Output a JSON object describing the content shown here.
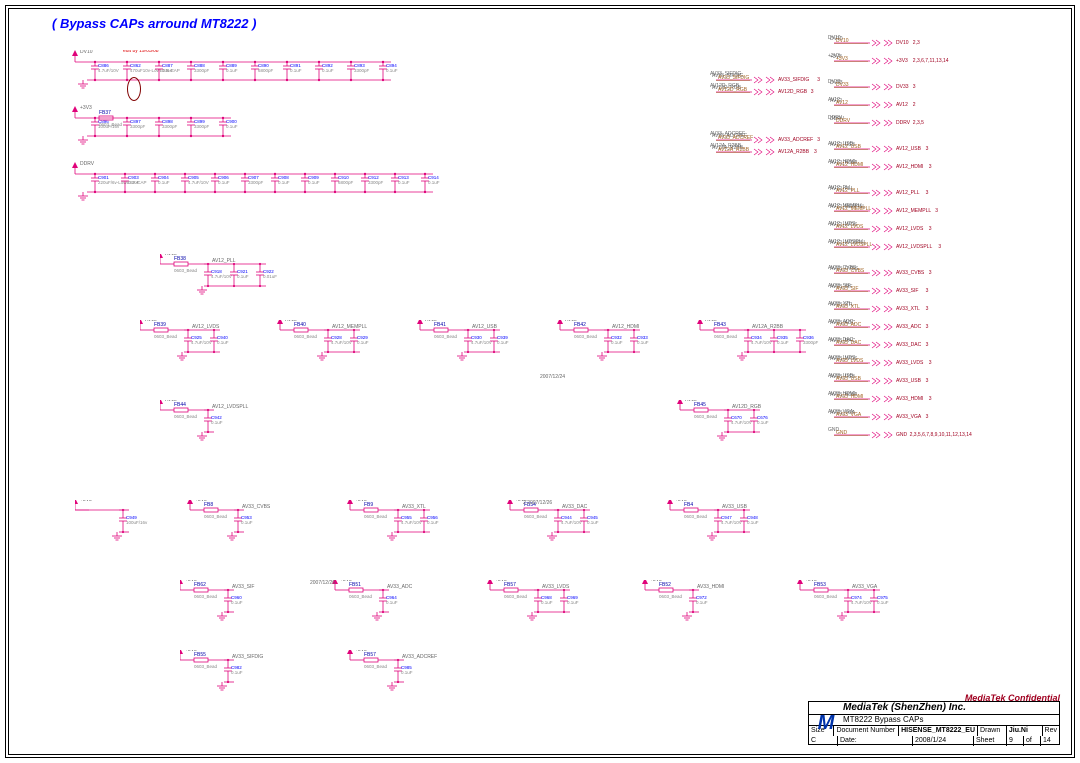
{
  "title": "( Bypass CAPs arround MT8222 )",
  "notes": {
    "edit": "edit by 19/05/08",
    "date1": "2007/12/24",
    "date2": "2 2007/12/26",
    "date3": "2007/12/26"
  },
  "confidential": "MediaTek Confidential",
  "titleblock": {
    "company": "MediaTek (ShenZhen) Inc.",
    "project": "MT8222 Bypass CAPs",
    "size": "Size",
    "size_v": "C",
    "docnum": "Document Number",
    "docnum_v": "HISENSE_MT8222_EU",
    "rev": "Rev",
    "rev_v": "1",
    "date": "Date:",
    "date_v": "2008/1/24",
    "sheet": "Sheet",
    "sheet_v": "9",
    "of": "of",
    "of_v": "14",
    "drawn": "Drawn",
    "drawn_v": "Jiu.Ni"
  },
  "rows_top": [
    {
      "net": "DV10",
      "caps": [
        {
          "ref": "C886",
          "val": "4.7uF/10V"
        },
        {
          "ref": "C862",
          "val": "470uF10v-LowESR-CAP"
        },
        {
          "ref": "C887",
          "val": "0.1uF"
        },
        {
          "ref": "C888",
          "val": "3300pF"
        },
        {
          "ref": "C889",
          "val": "0.1uF"
        },
        {
          "ref": "C890",
          "val": "6800pF"
        },
        {
          "ref": "C891",
          "val": "0.1uF"
        },
        {
          "ref": "C892",
          "val": "0.1uF"
        },
        {
          "ref": "C893",
          "val": "3300pF"
        },
        {
          "ref": "C894",
          "val": "0.1uF"
        }
      ]
    },
    {
      "net": "+3V3",
      "bead": {
        "ref": "FB37",
        "val": "0603_Bead"
      },
      "d": {
        "ref": "D103",
        "val": ""
      },
      "caps": [
        {
          "ref": "C896",
          "val": "100uF/16v"
        },
        {
          "ref": "C897",
          "val": "3300pF"
        },
        {
          "ref": "C898",
          "val": "3300pF"
        },
        {
          "ref": "C899",
          "val": "3300pF"
        },
        {
          "ref": "C900",
          "val": "0.1uF"
        }
      ]
    },
    {
      "net": "DDRV",
      "caps": [
        {
          "ref": "C901",
          "val": "220uF/6v-LowESR-CAP"
        },
        {
          "ref": "C903",
          "val": "0.1uF"
        },
        {
          "ref": "C904",
          "val": "0.1uF"
        },
        {
          "ref": "C905",
          "val": "4.7uF/10V"
        },
        {
          "ref": "C906",
          "val": "0.1uF"
        },
        {
          "ref": "C907",
          "val": "3300pF"
        },
        {
          "ref": "C908",
          "val": "0.1uF"
        },
        {
          "ref": "C909",
          "val": "0.1uF"
        },
        {
          "ref": "C910",
          "val": "6800pF"
        },
        {
          "ref": "C912",
          "val": "3300pF"
        },
        {
          "ref": "C913",
          "val": "0.1uF"
        },
        {
          "ref": "C914",
          "val": "0.1uF"
        }
      ]
    }
  ],
  "av12_pll": {
    "net": "AV12",
    "bead": {
      "ref": "FB38",
      "val": "0603_Bead"
    },
    "out": "AV12_PLL",
    "caps": [
      {
        "ref": "C918",
        "val": "4.7uF/10V"
      },
      {
        "ref": "C921",
        "val": "0.1uF"
      },
      {
        "ref": "C922",
        "val": "0.01uF"
      }
    ]
  },
  "mid_clusters": [
    {
      "net": "AV12",
      "bead": {
        "ref": "FB39",
        "val": "0603_Bead"
      },
      "out": "AV12_LVDS",
      "caps": [
        {
          "ref": "C925",
          "val": "4.7uF/10V"
        },
        {
          "ref": "C940",
          "val": "0.1uF"
        }
      ]
    },
    {
      "net": "AV12",
      "bead": {
        "ref": "FB40",
        "val": "0603_Bead"
      },
      "out": "AV12_MEMPLL",
      "caps": [
        {
          "ref": "C928",
          "val": "4.7uF/10V"
        },
        {
          "ref": "C929",
          "val": "0.1uF"
        }
      ]
    },
    {
      "net": "AV12",
      "bead": {
        "ref": "FB41",
        "val": "0603_Bead"
      },
      "out": "AV12_USB",
      "caps": [
        {
          "ref": "C930",
          "val": "4.7uF/10V"
        },
        {
          "ref": "C939",
          "val": "0.1uF"
        }
      ]
    },
    {
      "net": "AV12",
      "bead": {
        "ref": "FB42",
        "val": "0603_Bead"
      },
      "out": "AV12_HDMI",
      "caps": [
        {
          "ref": "C932",
          "val": "0.1uF"
        },
        {
          "ref": "C933",
          "val": "0.1uF"
        }
      ]
    },
    {
      "net": "AV12",
      "bead": {
        "ref": "FB43",
        "val": "0603_Bead"
      },
      "out": "AV12A_R2BB",
      "caps": [
        {
          "ref": "C934",
          "val": "4.7uF/10V"
        },
        {
          "ref": "C935",
          "val": "0.1uF"
        },
        {
          "ref": "C936",
          "val": "3300pF"
        }
      ]
    }
  ],
  "lvdspll": {
    "net": "AV12",
    "bead": {
      "ref": "FB44",
      "val": "0603_Bead"
    },
    "out": "AV12_LVDSPLL",
    "caps": [
      {
        "ref": "C942",
        "val": "0.1uF"
      }
    ]
  },
  "av12d_rgb": {
    "net": "AV12",
    "bead": {
      "ref": "FB45",
      "val": "0603_Bead"
    },
    "out": "AV12D_RGB",
    "caps": [
      {
        "ref": "C670",
        "val": "4.7uF/10V"
      },
      {
        "ref": "C676",
        "val": "0.1uF"
      }
    ]
  },
  "row_block_b": [
    {
      "net": "+3V3",
      "bead": null,
      "out": "",
      "caps": [
        {
          "ref": "C949",
          "val": "100uF/16v"
        }
      ]
    },
    {
      "net": "+3V3",
      "bead": {
        "ref": "FB8",
        "val": "0603_Bead"
      },
      "out": "AV33_CVBS",
      "caps": [
        {
          "ref": "C953",
          "val": "0.1uF"
        }
      ]
    },
    {
      "net": "+3V3",
      "bead": {
        "ref": "FB9",
        "val": "0603_Bead"
      },
      "out": "AV33_XTL",
      "caps": [
        {
          "ref": "C955",
          "val": "4.7uF/10V"
        },
        {
          "ref": "C956",
          "val": "0.1uF"
        }
      ]
    },
    {
      "net": "+3V3",
      "bead": {
        "ref": "FB54",
        "val": "0603_Bead"
      },
      "out": "AV33_DAC",
      "caps": [
        {
          "ref": "C944",
          "val": "4.7uF/10V"
        },
        {
          "ref": "C945",
          "val": "0.1uF"
        }
      ]
    },
    {
      "net": "+3V3",
      "bead": {
        "ref": "FB4",
        "val": "0603_Bead"
      },
      "out": "AV33_USB",
      "caps": [
        {
          "ref": "C947",
          "val": "4.7uF/10V"
        },
        {
          "ref": "C948",
          "val": "0.1uF"
        }
      ]
    }
  ],
  "row_block_c": [
    {
      "net": "+3V3",
      "bead": {
        "ref": "FB62",
        "val": "0603_Bead"
      },
      "out": "AV33_SIF",
      "caps": [
        {
          "ref": "C960",
          "val": "0.1uF"
        }
      ]
    },
    {
      "net": "+3V3",
      "bead": {
        "ref": "FB51",
        "val": "0603_Bead"
      },
      "out": "AV33_ADC",
      "caps": [
        {
          "ref": "C964",
          "val": "0.1uF"
        }
      ]
    },
    {
      "net": "+3V3",
      "bead": {
        "ref": "FB57",
        "val": "0603_Bead"
      },
      "out": "AV33_LVDS",
      "caps": [
        {
          "ref": "C968",
          "val": "0.1uF"
        },
        {
          "ref": "C969",
          "val": "0.1uF"
        }
      ]
    },
    {
      "net": "+3V3",
      "bead": {
        "ref": "FB52",
        "val": "0603_Bead"
      },
      "out": "AV33_HDMI",
      "caps": [
        {
          "ref": "C972",
          "val": "0.1uF"
        }
      ]
    },
    {
      "net": "+3V3",
      "bead": {
        "ref": "FB53",
        "val": "0603_Bead"
      },
      "out": "AV33_VGA",
      "caps": [
        {
          "ref": "C974",
          "val": "4.7uF/10V"
        },
        {
          "ref": "C975",
          "val": "0.1uF"
        }
      ]
    }
  ],
  "row_block_d": [
    {
      "net": "+3V3",
      "bead": {
        "ref": "FB55",
        "val": "0603_Bead"
      },
      "out": "AV33_SIFDIG",
      "caps": [
        {
          "ref": "C982",
          "val": "0.1uF"
        }
      ]
    },
    {
      "net": "+3V3",
      "bead": {
        "ref": "FB57",
        "val": "0603_Bead"
      },
      "out": "AV33_ADCREF",
      "caps": [
        {
          "ref": "C985",
          "val": "0.1uF"
        }
      ]
    }
  ],
  "offpage_center": [
    {
      "in": "AV33_SIFDIG",
      "out": "AV33_SIFDIG",
      "page": "3",
      "net": "AV33_SIFDIG"
    },
    {
      "in": "AV12D_RGB",
      "out": "AV12D_RGB",
      "page": "3",
      "net": "AV12D_RGB"
    },
    {
      "in": "AV33_ADCREF",
      "out": "AV33_ADCREF",
      "page": "3",
      "net": "AV33_ADCREF"
    },
    {
      "in": "AV12A_R2BB",
      "out": "AV12A_R2BB",
      "page": "3",
      "net": "AV12A_R2BB"
    }
  ],
  "offpage_right": [
    {
      "net": "DV10",
      "in": "DV10",
      "out": "DV10",
      "page": "2,3"
    },
    {
      "net": "+3V3",
      "in": "+3V3",
      "out": "+3V3",
      "page": "2,3,6,7,11,13,14"
    },
    {
      "net": "DV33",
      "in": "DV33",
      "out": "DV33",
      "page": "3"
    },
    {
      "net": "AV12",
      "in": "AV12",
      "out": "AV12",
      "page": "2"
    },
    {
      "net": "DDRV",
      "in": "DDRV",
      "out": "DDRV",
      "page": "2,3,5"
    },
    {
      "net": "AV12_USB",
      "in": "AV12_USB",
      "out": "AV12_USB",
      "page": "3"
    },
    {
      "net": "AV12_HDMI",
      "in": "AV12_HDMI",
      "out": "AV12_HDMI",
      "page": "3"
    },
    {
      "net": "AV12_PLL",
      "in": "AV12_PLL",
      "out": "AV12_PLL",
      "page": "3"
    },
    {
      "net": "AV12_MEMPLL",
      "in": "AV12_MEMPLL",
      "out": "AV12_MEMPLL",
      "page": "3"
    },
    {
      "net": "AV12_LVDS",
      "in": "AV12_LVDS",
      "out": "AV12_LVDS",
      "page": "3"
    },
    {
      "net": "AV12_LVDSPLL",
      "in": "AV12_LVDSPLL",
      "out": "AV12_LVDSPLL",
      "page": "3"
    },
    {
      "net": "AV33_CVBS",
      "in": "AV33_CVBS",
      "out": "AV33_CVBS",
      "page": "3"
    },
    {
      "net": "AV33_SIF",
      "in": "AV33_SIF",
      "out": "AV33_SIF",
      "page": "3"
    },
    {
      "net": "AV33_XTL",
      "in": "AV33_XTL",
      "out": "AV33_XTL",
      "page": "3"
    },
    {
      "net": "AV33_ADC",
      "in": "AV33_ADC",
      "out": "AV33_ADC",
      "page": "3"
    },
    {
      "net": "AV33_DAC",
      "in": "AV33_DAC",
      "out": "AV33_DAC",
      "page": "3"
    },
    {
      "net": "AV33_LVDS",
      "in": "AV33_LVDS",
      "out": "AV33_LVDS",
      "page": "3"
    },
    {
      "net": "AV33_USB",
      "in": "AV33_USB",
      "out": "AV33_USB",
      "page": "3"
    },
    {
      "net": "AV33_HDMI",
      "in": "AV33_HDMI",
      "out": "AV33_HDMI",
      "page": "3"
    },
    {
      "net": "AV33_VGA",
      "in": "AV33_VGA",
      "out": "AV33_VGA",
      "page": "3"
    },
    {
      "net": "GND",
      "in": "GND",
      "out": "GND",
      "page": "2,3,5,6,7,8,9,10,11,12,13,14"
    }
  ]
}
